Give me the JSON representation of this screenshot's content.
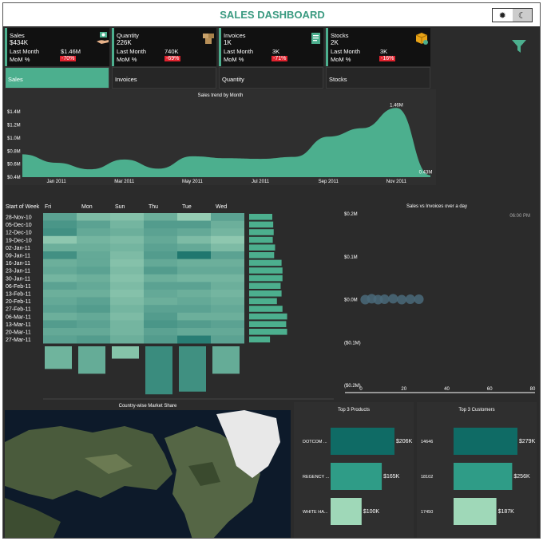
{
  "title": "SALES DASHBOARD",
  "theme_toggle": {
    "light_icon": "sun-icon",
    "dark_icon": "moon-icon",
    "selected": "dark"
  },
  "colors": {
    "accent": "#4caf8e",
    "dark_teal": "#0f6b65",
    "light_green": "#9fd8b8",
    "badge_red": "#e0222e"
  },
  "cards": [
    {
      "name": "Sales",
      "value": "$434K",
      "last_month_label": "Last Month",
      "last_month_value": "$1.46M",
      "mom_label": "MoM %",
      "mom_value": "-70%",
      "icon": "money-hand-icon"
    },
    {
      "name": "Quantity",
      "value": "226K",
      "last_month_label": "Last Month",
      "last_month_value": "740K",
      "mom_label": "MoM %",
      "mom_value": "-69%",
      "icon": "boxes-icon"
    },
    {
      "name": "Invoices",
      "value": "1K",
      "last_month_label": "Last Month",
      "last_month_value": "3K",
      "mom_label": "MoM %",
      "mom_value": "-71%",
      "icon": "invoice-icon"
    },
    {
      "name": "Stocks",
      "value": "2K",
      "last_month_label": "Last Month",
      "last_month_value": "3K",
      "mom_label": "MoM %",
      "mom_value": "-16%",
      "icon": "package-icon"
    }
  ],
  "tabs": [
    {
      "label": "Sales",
      "active": true
    },
    {
      "label": "Invoices",
      "active": false
    },
    {
      "label": "Quantity",
      "active": false
    },
    {
      "label": "Stocks",
      "active": false
    }
  ],
  "chart_data": [
    {
      "type": "area",
      "title": "Sales trend by Month",
      "x_ticks": [
        "Jan 2011",
        "Mar 2011",
        "May 2011",
        "Jul 2011",
        "Sep 2011",
        "Nov 2011"
      ],
      "y_ticks": [
        "$0.4M",
        "$0.6M",
        "$0.8M",
        "$1.0M",
        "$1.2M",
        "$1.4M"
      ],
      "ylim": [
        0.4,
        1.5
      ],
      "x": [
        "Dec 2010",
        "Jan 2011",
        "Feb 2011",
        "Mar 2011",
        "Apr 2011",
        "May 2011",
        "Jun 2011",
        "Jul 2011",
        "Aug 2011",
        "Sep 2011",
        "Oct 2011",
        "Nov 2011",
        "Dec 2011"
      ],
      "values": [
        0.75,
        0.62,
        0.52,
        0.67,
        0.53,
        0.72,
        0.69,
        0.68,
        0.71,
        1.02,
        1.15,
        1.46,
        0.43
      ],
      "data_labels": [
        {
          "x": "Nov 2011",
          "text": "1.46M"
        },
        {
          "x": "Dec 2011",
          "text": "0.43M"
        }
      ]
    },
    {
      "type": "heatmap",
      "title": "",
      "corner_label": "Start of Week",
      "columns": [
        "Fri",
        "Mon",
        "Sun",
        "Thu",
        "Tue",
        "Wed"
      ],
      "rows": [
        "28-Nov-10",
        "05-Dec-10",
        "12-Dec-10",
        "19-Dec-10",
        "02-Jan-11",
        "09-Jan-11",
        "16-Jan-11",
        "23-Jan-11",
        "30-Jan-11",
        "06-Feb-11",
        "13-Feb-11",
        "20-Feb-11",
        "27-Feb-11",
        "06-Mar-11",
        "13-Mar-11",
        "20-Mar-11",
        "27-Mar-11"
      ],
      "values": [
        [
          0.55,
          0.35,
          0.3,
          0.45,
          0.2,
          0.55
        ],
        [
          0.65,
          0.55,
          0.4,
          0.6,
          0.6,
          0.45
        ],
        [
          0.7,
          0.5,
          0.45,
          0.55,
          0.5,
          0.4
        ],
        [
          0.25,
          0.4,
          0.35,
          0.5,
          0.35,
          0.25
        ],
        [
          0.45,
          0.45,
          0.4,
          0.55,
          0.5,
          0.35
        ],
        [
          0.7,
          0.5,
          0.35,
          0.6,
          0.9,
          0.55
        ],
        [
          0.45,
          0.5,
          0.3,
          0.5,
          0.45,
          0.45
        ],
        [
          0.5,
          0.55,
          0.35,
          0.6,
          0.5,
          0.5
        ],
        [
          0.4,
          0.45,
          0.3,
          0.45,
          0.4,
          0.4
        ],
        [
          0.55,
          0.5,
          0.35,
          0.55,
          0.55,
          0.45
        ],
        [
          0.45,
          0.45,
          0.3,
          0.5,
          0.45,
          0.4
        ],
        [
          0.5,
          0.55,
          0.35,
          0.45,
          0.5,
          0.45
        ],
        [
          0.55,
          0.6,
          0.4,
          0.55,
          0.55,
          0.5
        ],
        [
          0.45,
          0.5,
          0.35,
          0.6,
          0.45,
          0.45
        ],
        [
          0.6,
          0.55,
          0.4,
          0.65,
          0.6,
          0.55
        ],
        [
          0.5,
          0.5,
          0.4,
          0.55,
          0.5,
          0.5
        ],
        [
          0.55,
          0.6,
          0.45,
          0.6,
          0.85,
          0.55
        ]
      ],
      "row_totals": [
        0.5,
        0.52,
        0.53,
        0.51,
        0.56,
        0.54,
        0.7,
        0.72,
        0.72,
        0.68,
        0.7,
        0.6,
        0.72,
        0.82,
        0.8,
        0.82,
        0.45
      ],
      "column_totals": [
        0.33,
        0.4,
        0.18,
        0.7,
        0.66,
        0.4
      ]
    },
    {
      "type": "scatter",
      "title": "Sales vs Invoices over a day",
      "annotation": "06:00 PM",
      "y_ticks": [
        "$0.2M",
        "$0.1M",
        "$0.0M",
        "($0.1M)",
        "($0.2M)"
      ],
      "x_ticks": [
        "0",
        "20",
        "40",
        "60",
        "80"
      ],
      "xlim": [
        0,
        80
      ],
      "ylim": [
        -0.2,
        0.2
      ],
      "points": [
        {
          "x": 2,
          "y": 0.0
        },
        {
          "x": 5,
          "y": 0.002
        },
        {
          "x": 8,
          "y": 0.0
        },
        {
          "x": 11,
          "y": 0.001
        },
        {
          "x": 15,
          "y": 0.002
        },
        {
          "x": 19,
          "y": 0.0
        },
        {
          "x": 23,
          "y": 0.001
        },
        {
          "x": 27,
          "y": 0.001
        }
      ]
    },
    {
      "type": "bar",
      "title": "Top 3 Products",
      "categories": [
        "DOTCOM ...",
        "REGENCY ...",
        "WHITE HA..."
      ],
      "values": [
        206,
        165,
        100
      ],
      "labels": [
        "$206K",
        "$165K",
        "$100K"
      ]
    },
    {
      "type": "bar",
      "title": "Top 3 Customers",
      "categories": [
        "14646",
        "18102",
        "17450"
      ],
      "values": [
        279,
        256,
        187
      ],
      "labels": [
        "$279K",
        "$256K",
        "$187K"
      ]
    }
  ],
  "map": {
    "title": "Country-wise Market Share"
  }
}
